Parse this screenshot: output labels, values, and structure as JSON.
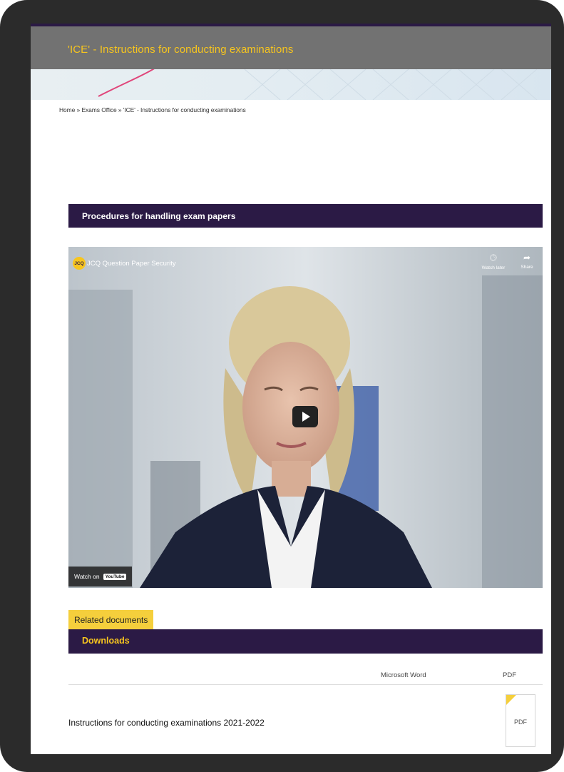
{
  "header": {
    "title": "'ICE' - Instructions for conducting examinations"
  },
  "breadcrumb": {
    "home": "Home",
    "separator": "»",
    "section": "Exams Office",
    "current": "'ICE' - Instructions for conducting examinations"
  },
  "procedures_section": {
    "title": "Procedures for handling exam papers"
  },
  "video": {
    "channel_logo": "JCQ",
    "title": "JCQ Question Paper Security",
    "watch_later_label": "Watch later",
    "share_label": "Share",
    "watch_on_label": "Watch on",
    "youtube_label": "YouTube"
  },
  "related": {
    "tab_label": "Related documents"
  },
  "downloads": {
    "title": "Downloads",
    "columns": {
      "word": "Microsoft Word",
      "pdf": "PDF"
    },
    "rows": [
      {
        "title": "Instructions for conducting examinations 2021-2022",
        "pdf_label": "PDF"
      }
    ]
  },
  "colors": {
    "brand_purple": "#2b1a45",
    "brand_yellow": "#f7c51e",
    "header_grey": "#727272"
  }
}
